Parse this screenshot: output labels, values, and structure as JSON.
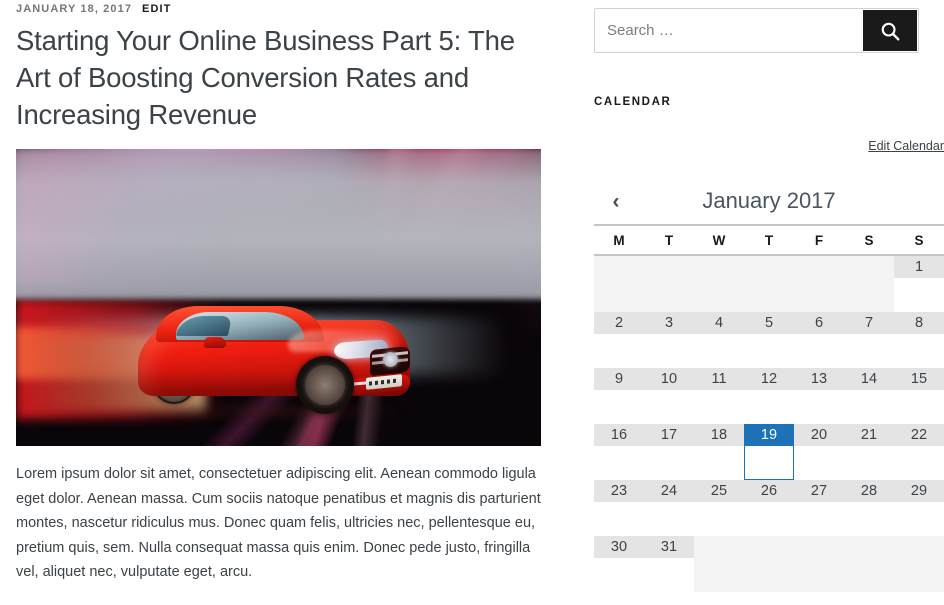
{
  "article": {
    "date": "JANUARY 18, 2017",
    "edit_label": "EDIT",
    "title": "Starting Your Online Business Part 5: The Art of Boosting Conversion Rates and Increasing Revenue",
    "featured_image_alt": "Red Mercedes-Benz car driving at night with motion-blurred pink and red light streaks",
    "body": "Lorem ipsum dolor sit amet, consectetuer adipiscing elit. Aenean commodo ligula eget dolor. Aenean massa. Cum sociis natoque penatibus et magnis dis parturient montes, nascetur ridiculus mus. Donec quam felis, ultricies nec, pellentesque eu, pretium quis, sem. Nulla consequat massa quis enim. Donec pede justo, fringilla vel, aliquet nec, vulputate eget, arcu."
  },
  "search": {
    "value": "",
    "placeholder": "Search …",
    "submit_icon": "search-icon"
  },
  "calendar_widget": {
    "title": "CALENDAR",
    "edit_link": "Edit Calendar",
    "prev_icon": "chevron-left-icon",
    "prev_label": "‹",
    "month_label": "January 2017",
    "month": "January",
    "year": "2017",
    "weekday_headers": [
      "M",
      "T",
      "W",
      "T",
      "F",
      "S",
      "S"
    ],
    "selected_day": "19",
    "accent_color": "#1d72b8",
    "day_band_color": "#e4e4e4",
    "empty_cell_color": "#f4f4f4",
    "weeks": [
      [
        {
          "day": "",
          "state": "empty"
        },
        {
          "day": "",
          "state": "empty"
        },
        {
          "day": "",
          "state": "empty"
        },
        {
          "day": "",
          "state": "empty"
        },
        {
          "day": "",
          "state": "empty"
        },
        {
          "day": "",
          "state": "empty"
        },
        {
          "day": "1",
          "state": "normal"
        }
      ],
      [
        {
          "day": "2",
          "state": "normal"
        },
        {
          "day": "3",
          "state": "normal"
        },
        {
          "day": "4",
          "state": "normal"
        },
        {
          "day": "5",
          "state": "normal"
        },
        {
          "day": "6",
          "state": "normal"
        },
        {
          "day": "7",
          "state": "normal"
        },
        {
          "day": "8",
          "state": "normal"
        }
      ],
      [
        {
          "day": "9",
          "state": "normal"
        },
        {
          "day": "10",
          "state": "normal"
        },
        {
          "day": "11",
          "state": "normal"
        },
        {
          "day": "12",
          "state": "normal"
        },
        {
          "day": "13",
          "state": "normal"
        },
        {
          "day": "14",
          "state": "normal"
        },
        {
          "day": "15",
          "state": "normal"
        }
      ],
      [
        {
          "day": "16",
          "state": "normal"
        },
        {
          "day": "17",
          "state": "normal"
        },
        {
          "day": "18",
          "state": "normal"
        },
        {
          "day": "19",
          "state": "today"
        },
        {
          "day": "20",
          "state": "normal"
        },
        {
          "day": "21",
          "state": "normal"
        },
        {
          "day": "22",
          "state": "normal"
        }
      ],
      [
        {
          "day": "23",
          "state": "normal"
        },
        {
          "day": "24",
          "state": "normal"
        },
        {
          "day": "25",
          "state": "normal"
        },
        {
          "day": "26",
          "state": "normal"
        },
        {
          "day": "27",
          "state": "normal"
        },
        {
          "day": "28",
          "state": "normal"
        },
        {
          "day": "29",
          "state": "normal"
        }
      ],
      [
        {
          "day": "30",
          "state": "normal"
        },
        {
          "day": "31",
          "state": "normal"
        },
        {
          "day": "",
          "state": "empty"
        },
        {
          "day": "",
          "state": "empty"
        },
        {
          "day": "",
          "state": "empty"
        },
        {
          "day": "",
          "state": "empty"
        },
        {
          "day": "",
          "state": "empty"
        }
      ]
    ]
  }
}
